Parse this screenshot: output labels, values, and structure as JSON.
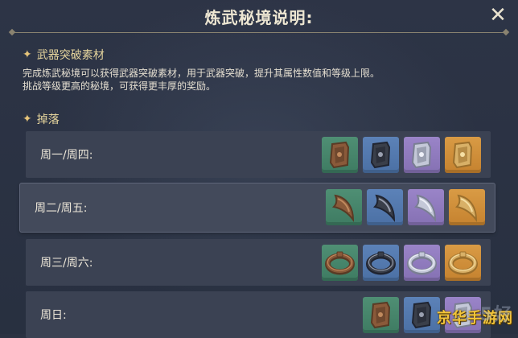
{
  "header": {
    "title": "炼武秘境说明:",
    "close_label": "✕"
  },
  "section_material": {
    "heading": "武器突破素材",
    "description_line1": "完成炼武秘境可以获得武器突破素材，用于武器突破，提升其属性数值和等级上限。",
    "description_line2": "挑战等级更高的秘境，可获得更丰厚的奖励。"
  },
  "section_drops": {
    "heading": "掉落",
    "rows": [
      {
        "label": "周一/周四:",
        "item_type": "tablet",
        "icons": [
          "green-tablet-icon",
          "blue-tablet-icon",
          "purple-tablet-icon",
          "gold-tablet-icon"
        ]
      },
      {
        "label": "周二/周五:",
        "item_type": "fang",
        "icons": [
          "green-fang-icon",
          "blue-fang-icon",
          "purple-fang-icon",
          "gold-fang-icon"
        ]
      },
      {
        "label": "周三/周六:",
        "item_type": "ring",
        "icons": [
          "green-ring-icon",
          "blue-ring-icon",
          "purple-ring-icon",
          "gold-ring-icon"
        ]
      },
      {
        "label": "周日:",
        "item_type": "tablet",
        "icons": [
          "green-tablet-icon",
          "blue-tablet-icon",
          "purple-tablet-icon"
        ]
      }
    ]
  },
  "colors": {
    "background": "#2b3242",
    "heading": "#e6d59d",
    "quality_green": "#4f8f74",
    "quality_blue": "#5c82b8",
    "quality_purple": "#9a84c8",
    "quality_gold": "#d99b45"
  },
  "watermark": {
    "text": "京华手游网"
  }
}
